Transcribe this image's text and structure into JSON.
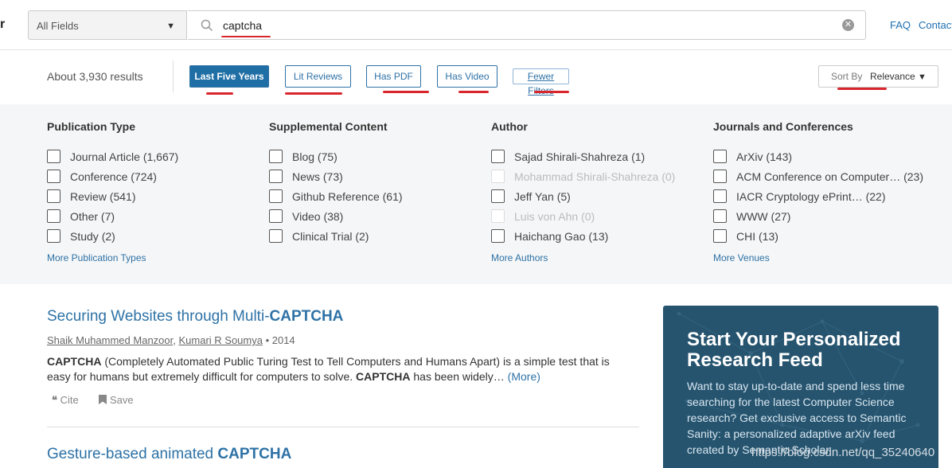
{
  "header": {
    "logo_fragment": "r",
    "field_select": "All Fields",
    "search_value": "captcha",
    "links": [
      "FAQ",
      "Contact"
    ]
  },
  "filters": {
    "results_count": "About 3,930 results",
    "chips": [
      "Last Five Years",
      "Lit Reviews",
      "Has PDF",
      "Has Video",
      "Fewer Filters"
    ],
    "sort_label": "Sort By",
    "sort_value": "Relevance"
  },
  "facets": [
    {
      "title": "Publication Type",
      "options": [
        "Journal Article (1,667)",
        "Conference (724)",
        "Review (541)",
        "Other (7)",
        "Study (2)"
      ],
      "more": "More Publication Types"
    },
    {
      "title": "Supplemental Content",
      "options": [
        "Blog (75)",
        "News (73)",
        "Github Reference (61)",
        "Video (38)",
        "Clinical Trial (2)"
      ],
      "more": ""
    },
    {
      "title": "Author",
      "options": [
        "Sajad Shirali-Shahreza (1)",
        "Mohammad Shirali-Shahreza (0)",
        "Jeff Yan (5)",
        "Luis von Ahn (0)",
        "Haichang Gao (13)"
      ],
      "more": "More Authors"
    },
    {
      "title": "Journals and Conferences",
      "options": [
        "ArXiv (143)",
        "ACM Conference on Computer… (23)",
        "IACR Cryptology ePrint… (22)",
        "WWW (27)",
        "CHI (13)"
      ],
      "more": "More Venues"
    }
  ],
  "results": [
    {
      "title_pre": "Securing Websites through Multi-",
      "title_bold": "CAPTCHA",
      "author1": "Shaik Muhammed Manzoor",
      "author2": "Kumari R Soumya",
      "year": " • 2014",
      "abs_b1": "CAPTCHA",
      "abs_t1": " (Completely Automated Public Turing Test to Tell Computers and Humans Apart) is a simple test that is easy for humans but extremely difficult for computers to solve. ",
      "abs_b2": "CAPTCHA",
      "abs_t2": " has been widely… ",
      "abs_more": "(More)",
      "cite": "Cite",
      "save": "Save"
    },
    {
      "title_pre": "Gesture-based animated ",
      "title_bold": "CAPTCHA"
    }
  ],
  "promo": {
    "title": "Start Your Personalized Research Feed",
    "body": "Want to stay up-to-date and spend less time searching for the latest Computer Science research? Get exclusive access to Semantic Sanity: a personalized adaptive arXiv feed created by Semantic Scholar."
  },
  "watermark": "https://blog.csdn.net/qq_35240640",
  "colors": {
    "accent": "#2e72a6",
    "annotation_red": "#d9262d",
    "promo_bg": "#26546f"
  }
}
